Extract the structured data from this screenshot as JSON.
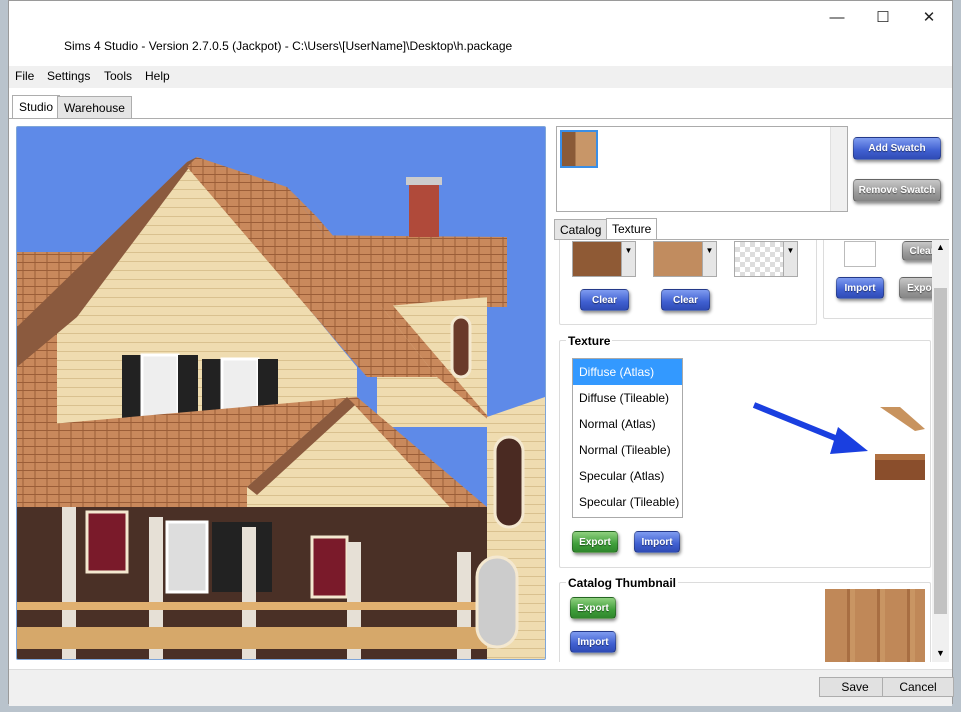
{
  "window": {
    "title": "Sims 4 Studio - Version 2.7.0.5  (Jackpot)   - C:\\Users\\[UserName]\\Desktop\\h.package",
    "minimize": "—",
    "maximize": "☐",
    "close": "✕"
  },
  "menu": [
    "File",
    "Settings",
    "Tools",
    "Help"
  ],
  "tabs": [
    "Studio",
    "Warehouse"
  ],
  "swatch": {
    "add_label": "Add Swatch",
    "remove_label": "Remove Swatch"
  },
  "subtabs": [
    "Catalog",
    "Texture"
  ],
  "colors": {
    "swatch1": "#8f5a35",
    "swatch2": "#c18c5f",
    "accent_blue": "#3399ff"
  },
  "buttons": {
    "clear": "Clear",
    "import": "Import",
    "export": "Export"
  },
  "texture": {
    "title": "Texture",
    "items": [
      "Diffuse (Atlas)",
      "Diffuse (Tileable)",
      "Normal (Atlas)",
      "Normal (Tileable)",
      "Specular (Atlas)",
      "Specular (Tileable)"
    ]
  },
  "catalog_thumb": {
    "title": "Catalog Thumbnail"
  },
  "footer": {
    "save": "Save",
    "cancel": "Cancel"
  }
}
